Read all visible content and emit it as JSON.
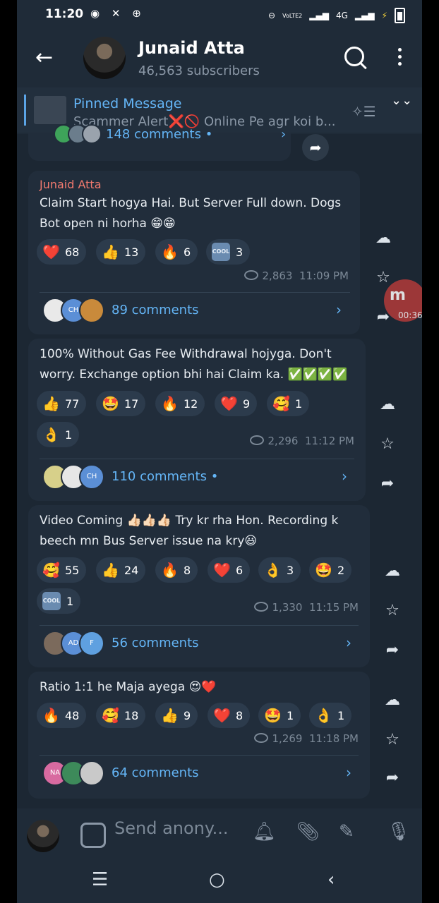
{
  "status": {
    "time": "11:20",
    "network": "4G",
    "volte": "VoLTE2"
  },
  "channel": {
    "name": "Junaid Atta",
    "subscribers": "46,563 subscribers"
  },
  "pinned": {
    "title": "Pinned Message",
    "text": "Scammer Alert❌🚫  Online Pe agr koi b..."
  },
  "prev_post": {
    "comments": "148 comments •"
  },
  "posts": [
    {
      "author": "Junaid Atta",
      "text": "Claim Start hogya Hai. But Server Full down. Dogs Bot open ni horha 😁😁",
      "reactions": [
        {
          "emoji": "❤️",
          "count": "68"
        },
        {
          "emoji": "👍",
          "count": "13"
        },
        {
          "emoji": "🔥",
          "count": "6"
        },
        {
          "emoji": "cool",
          "count": "3"
        }
      ],
      "views": "2,863",
      "time": "11:09 PM",
      "comments": "89 comments",
      "avatars": [
        "",
        "CH",
        ""
      ]
    },
    {
      "author": "",
      "text": "100% Without Gas Fee Withdrawal hojyga. Don't worry. Exchange option bhi hai Claim ka. ✅✅✅✅",
      "reactions": [
        {
          "emoji": "👍",
          "count": "77"
        },
        {
          "emoji": "🤩",
          "count": "17"
        },
        {
          "emoji": "🔥",
          "count": "12"
        },
        {
          "emoji": "❤️",
          "count": "9"
        },
        {
          "emoji": "🥰",
          "count": "1"
        },
        {
          "emoji": "👌",
          "count": "1"
        }
      ],
      "views": "2,296",
      "time": "11:12 PM",
      "comments": "110 comments •",
      "avatars": [
        "",
        "",
        "CH"
      ]
    },
    {
      "author": "",
      "text": "Video Coming 👍🏻👍🏻👍🏻 Try kr rha Hon. Recording k beech mn Bus Server issue na kry😃",
      "reactions": [
        {
          "emoji": "🥰",
          "count": "55"
        },
        {
          "emoji": "👍",
          "count": "24"
        },
        {
          "emoji": "🔥",
          "count": "8"
        },
        {
          "emoji": "❤️",
          "count": "6"
        },
        {
          "emoji": "👌",
          "count": "3"
        },
        {
          "emoji": "🤩",
          "count": "2"
        },
        {
          "emoji": "cool",
          "count": "1"
        }
      ],
      "views": "1,330",
      "time": "11:15 PM",
      "comments": "56 comments",
      "avatars": [
        "",
        "AD",
        "F"
      ]
    },
    {
      "author": "",
      "text": "Ratio 1:1 he Maja ayega 😍❤️",
      "reactions": [
        {
          "emoji": "🔥",
          "count": "48"
        },
        {
          "emoji": "🥰",
          "count": "18"
        },
        {
          "emoji": "👍",
          "count": "9"
        },
        {
          "emoji": "❤️",
          "count": "8"
        },
        {
          "emoji": "🤩",
          "count": "1"
        },
        {
          "emoji": "👌",
          "count": "1"
        }
      ],
      "views": "1,269",
      "time": "11:18 PM",
      "comments": "64 comments",
      "avatars": [
        "NA",
        "",
        ""
      ]
    }
  ],
  "recorder": {
    "label": "m",
    "time": "00:36"
  },
  "composer": {
    "placeholder": "Send anony..."
  },
  "colors": {
    "accent": "#64b5f6",
    "bubble": "#212d3b",
    "author": "#f27a6f"
  }
}
